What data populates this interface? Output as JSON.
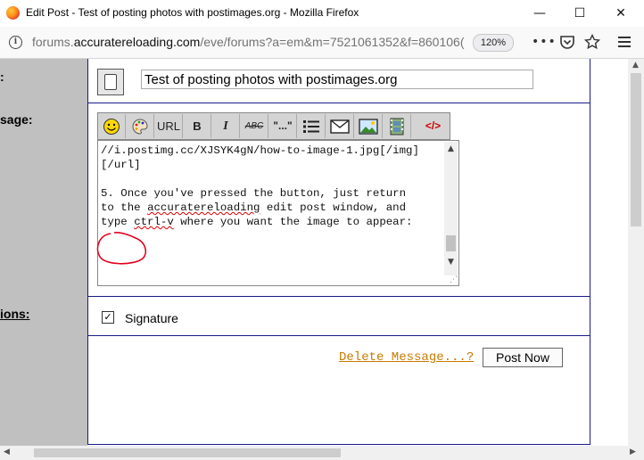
{
  "window": {
    "title": "Edit Post - Test of posting photos with postimages.org - Mozilla Firefox",
    "minimize_glyph": "—",
    "maximize_glyph": "☐",
    "close_glyph": "✕"
  },
  "addressbar": {
    "url_prefix": "forums.",
    "url_host": "accuratereloading.com",
    "url_rest": "/eve/forums?a=em&m=7521061352&f=860106(",
    "zoom": "120%",
    "icons": [
      "info-icon",
      "more-icon",
      "pocket-icon",
      "bookmark-star-icon",
      "menu-icon"
    ]
  },
  "left_labels": {
    "subject": ":",
    "message": "sage:",
    "options": "ions:"
  },
  "form": {
    "subject_value": "Test of posting photos with postimages.org",
    "toolbar_buttons": [
      {
        "name": "smiley-icon",
        "label": "☺"
      },
      {
        "name": "palette-icon",
        "label": "🎨"
      },
      {
        "name": "url-button",
        "label": "URL"
      },
      {
        "name": "bold-button",
        "label": "B"
      },
      {
        "name": "italic-button",
        "label": "I"
      },
      {
        "name": "strike-button",
        "label": "ABC"
      },
      {
        "name": "quote-button",
        "label": "\"...\""
      },
      {
        "name": "list-icon",
        "label": "☰"
      },
      {
        "name": "email-icon",
        "label": "✉"
      },
      {
        "name": "image-icon",
        "label": "▣"
      },
      {
        "name": "video-icon",
        "label": "▦"
      },
      {
        "name": "html-icon",
        "label": "</>"
      }
    ],
    "editor_lines": [
      "//i.postimg.cc/XJSYK4gN/how-to-image-1.jpg[/img]",
      "[/url]",
      "",
      "5. Once you've pressed the button, just return",
      "to the accuratereloading edit post window, and",
      "type ctrl-v where you want the image to appear:"
    ],
    "signature_checked": true,
    "signature_label": "Signature",
    "delete_link": "Delete Message...?",
    "post_button": "Post Now"
  },
  "colors": {
    "border_blue": "#1b1b8a",
    "delete_link": "#c77b00",
    "annotation_red": "#e0001b",
    "left_column": "#c0c0c0"
  }
}
